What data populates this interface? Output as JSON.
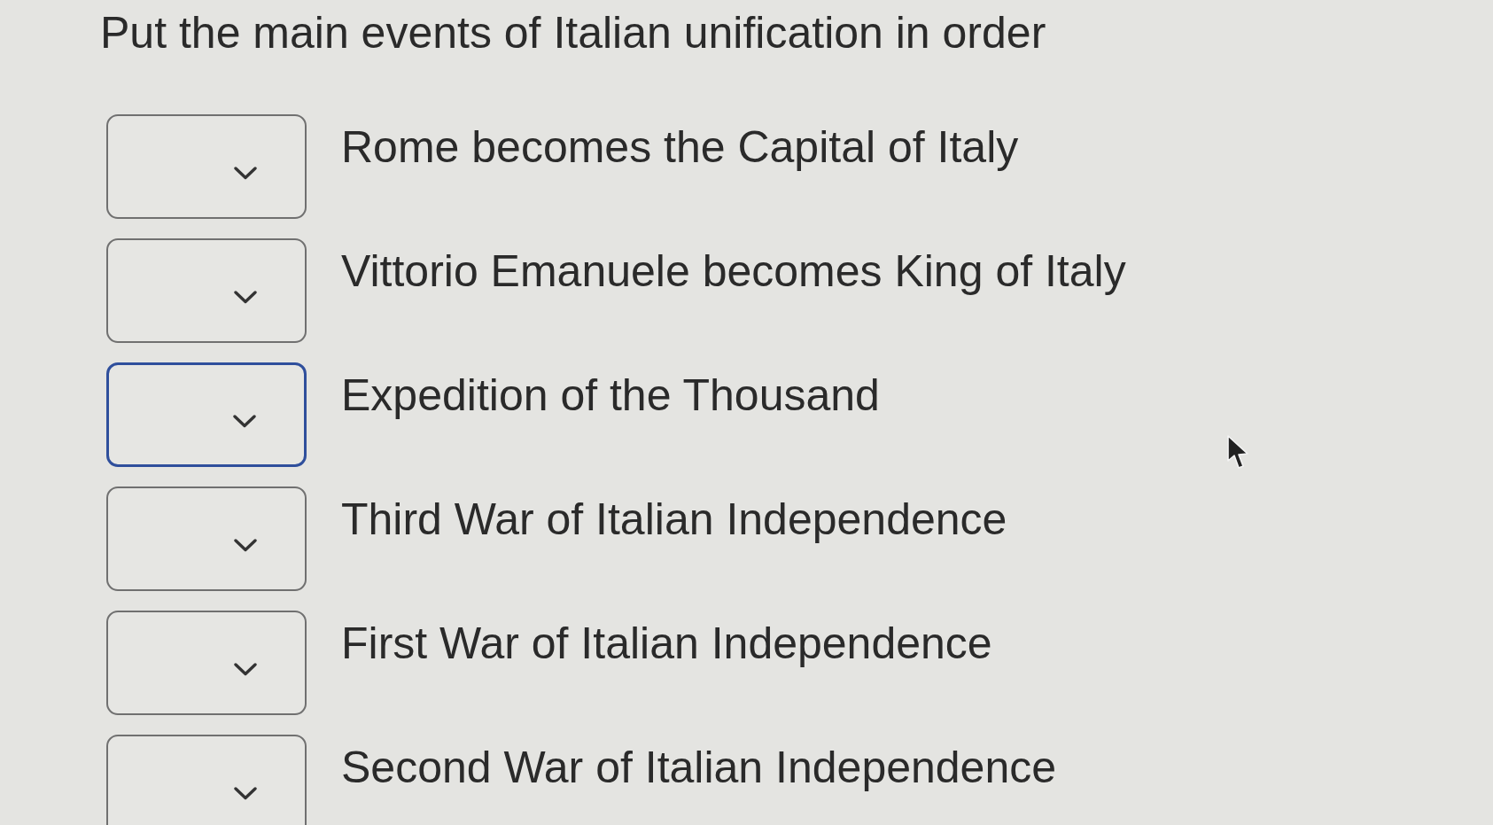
{
  "title": "Put the main events of Italian unification in order",
  "items": [
    {
      "label": "Rome becomes the Capital of Italy",
      "focused": false
    },
    {
      "label": "Vittorio Emanuele becomes King of Italy",
      "focused": false
    },
    {
      "label": "Expedition of the Thousand",
      "focused": true
    },
    {
      "label": "Third War of Italian Independence",
      "focused": false
    },
    {
      "label": "First War of Italian Independence",
      "focused": false
    },
    {
      "label": "Second War of Italian Independence",
      "focused": false
    }
  ]
}
